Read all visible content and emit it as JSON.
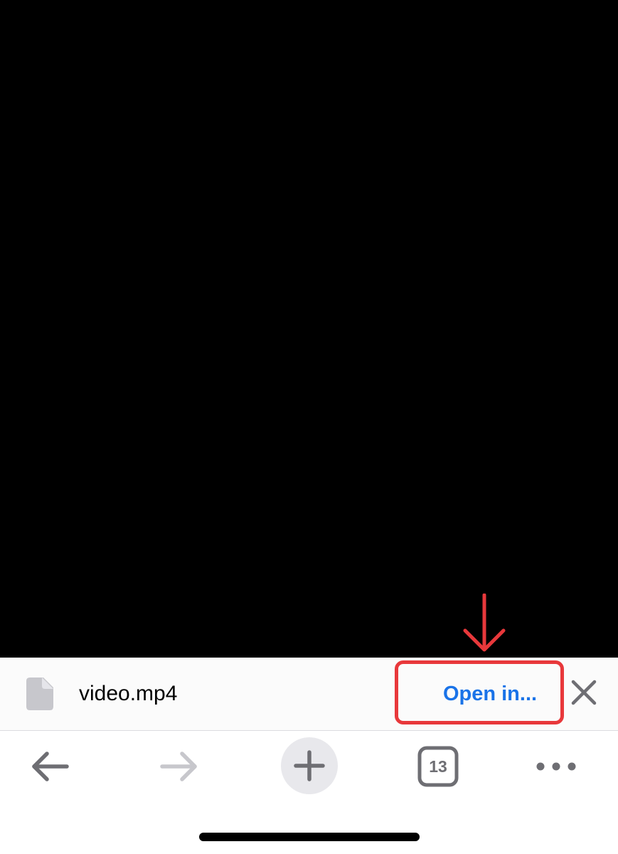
{
  "download_bar": {
    "file_icon": "document-icon",
    "file_name": "video.mp4",
    "open_in_label": "Open in...",
    "close_icon": "close-icon"
  },
  "annotation": {
    "arrow_icon": "arrow-down-icon",
    "highlight_color": "#e8383b"
  },
  "toolbar": {
    "back_icon": "back-arrow-icon",
    "forward_icon": "forward-arrow-icon",
    "new_tab_icon": "plus-icon",
    "tab_count": "13",
    "menu_icon": "more-dots-icon"
  },
  "colors": {
    "accent": "#1a73e8",
    "icon_gray": "#6e6e73",
    "icon_disabled": "#c7c7cc",
    "content_background": "#000000"
  }
}
